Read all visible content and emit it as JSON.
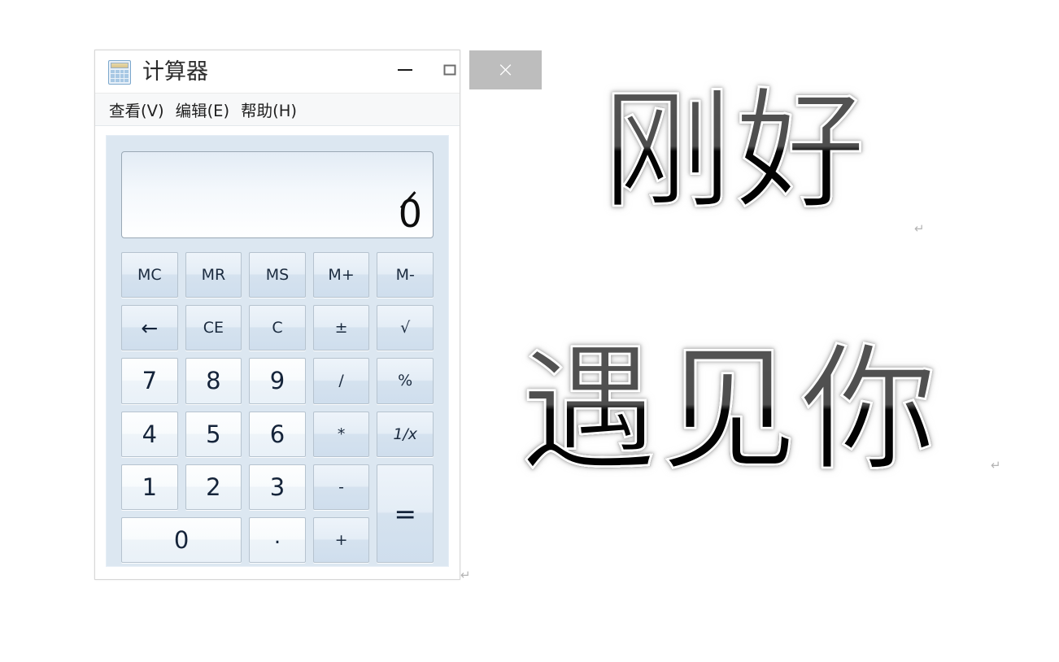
{
  "window": {
    "title": "计算器",
    "icon": "calculator-icon",
    "controls": {
      "minimize": "–",
      "maximize": "□",
      "close": "×"
    }
  },
  "menu": {
    "items": [
      {
        "label": "查看(V)"
      },
      {
        "label": "编辑(E)"
      },
      {
        "label": "帮助(H)"
      }
    ]
  },
  "display": {
    "value": "0"
  },
  "keypad": {
    "rows": [
      [
        {
          "label": "MC",
          "kind": "fn",
          "name": "key-memory-clear"
        },
        {
          "label": "MR",
          "kind": "fn",
          "name": "key-memory-recall"
        },
        {
          "label": "MS",
          "kind": "fn",
          "name": "key-memory-store"
        },
        {
          "label": "M+",
          "kind": "fn",
          "name": "key-memory-add"
        },
        {
          "label": "M-",
          "kind": "fn",
          "name": "key-memory-subtract"
        }
      ],
      [
        {
          "label": "←",
          "kind": "fn",
          "name": "key-backspace"
        },
        {
          "label": "CE",
          "kind": "fn",
          "name": "key-clear-entry"
        },
        {
          "label": "C",
          "kind": "fn",
          "name": "key-clear"
        },
        {
          "label": "±",
          "kind": "fn",
          "name": "key-sign"
        },
        {
          "label": "√",
          "kind": "fn",
          "name": "key-sqrt"
        }
      ],
      [
        {
          "label": "7",
          "kind": "num",
          "name": "key-7"
        },
        {
          "label": "8",
          "kind": "num",
          "name": "key-8"
        },
        {
          "label": "9",
          "kind": "num",
          "name": "key-9"
        },
        {
          "label": "/",
          "kind": "fn",
          "name": "key-divide"
        },
        {
          "label": "%",
          "kind": "fn",
          "name": "key-percent"
        }
      ],
      [
        {
          "label": "4",
          "kind": "num",
          "name": "key-4"
        },
        {
          "label": "5",
          "kind": "num",
          "name": "key-5"
        },
        {
          "label": "6",
          "kind": "num",
          "name": "key-6"
        },
        {
          "label": "*",
          "kind": "fn",
          "name": "key-multiply"
        },
        {
          "label": "1/x",
          "kind": "fn",
          "name": "key-reciprocal"
        }
      ],
      [
        {
          "label": "1",
          "kind": "num",
          "name": "key-1"
        },
        {
          "label": "2",
          "kind": "num",
          "name": "key-2"
        },
        {
          "label": "3",
          "kind": "num",
          "name": "key-3"
        },
        {
          "label": "-",
          "kind": "fn",
          "name": "key-subtract"
        },
        {
          "label": "=",
          "kind": "fn",
          "name": "key-equals"
        }
      ],
      [
        {
          "label": "0",
          "kind": "num",
          "name": "key-0"
        },
        {
          "label": ".",
          "kind": "num",
          "name": "key-decimal"
        },
        {
          "label": "+",
          "kind": "fn",
          "name": "key-add"
        }
      ]
    ]
  },
  "artwork": {
    "line1": "刚好",
    "line2": "遇见你",
    "pilcrow": "↵"
  },
  "colors": {
    "window_frame": "#d7d7d7",
    "title_bar": "#ffffff",
    "close_button": "#bdbdbd",
    "pad_background": "#dce7f1",
    "key_border": "#b6c3cf",
    "key_text": "#1b2b3f",
    "art_gradient_top": "#535353",
    "art_gradient_bottom": "#000000",
    "art_outline": "#ffffff"
  }
}
